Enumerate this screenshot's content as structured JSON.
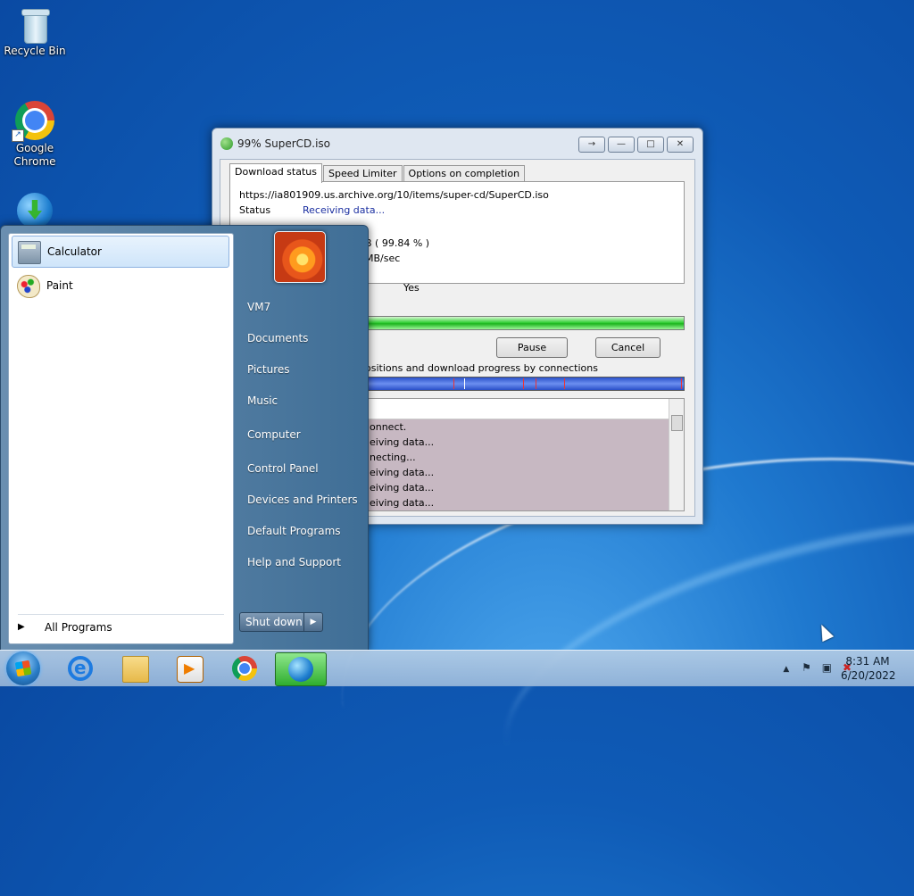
{
  "desktop": {
    "icons": [
      {
        "label": "Recycle Bin",
        "icon": "recycle-bin-icon"
      },
      {
        "label": "Google\nChrome",
        "icon": "chrome-icon"
      },
      {
        "label": "",
        "icon": "idm-icon"
      }
    ]
  },
  "idm_window": {
    "title": "99% SuperCD.iso",
    "title_buttons": [
      "→",
      "—",
      "□",
      "✕"
    ],
    "tabs": [
      "Download status",
      "Speed Limiter",
      "Options on completion"
    ],
    "url": "https://ia801909.us.archive.org/10/items/super-cd/SuperCD.iso",
    "status_label": "Status",
    "status_value": "Receiving data...",
    "partial_values": [
      "B ( 99.84 % )",
      "MB/sec",
      "Yes"
    ],
    "progress_percent": 99.84,
    "pause_button": "Pause",
    "cancel_button": "Cancel",
    "connections_label": "positions and download progress by connections",
    "connection_rows": [
      "onnect.",
      "eiving data...",
      "necting...",
      "eiving data...",
      "eiving data...",
      "eiving data..."
    ]
  },
  "start_menu": {
    "programs": [
      {
        "label": "Calculator",
        "icon": "calculator-icon",
        "highlighted": true
      },
      {
        "label": "Paint",
        "icon": "paint-icon",
        "highlighted": false
      }
    ],
    "all_programs": "All Programs",
    "right_items": [
      "VM7",
      "Documents",
      "Pictures",
      "Music",
      "Computer",
      "Control Panel",
      "Devices and Printers",
      "Default Programs",
      "Help and Support"
    ],
    "shutdown": "Shut down"
  },
  "taskbar": {
    "pinned": [
      "internet-explorer-icon",
      "windows-explorer-icon",
      "media-player-icon",
      "chrome-icon",
      "idm-icon"
    ],
    "tray_icons": [
      "show-hidden-icons",
      "action-center-flag-icon",
      "network-icon",
      "volume-muted-icon"
    ],
    "time": "8:31 AM",
    "date": "6/20/2022"
  }
}
